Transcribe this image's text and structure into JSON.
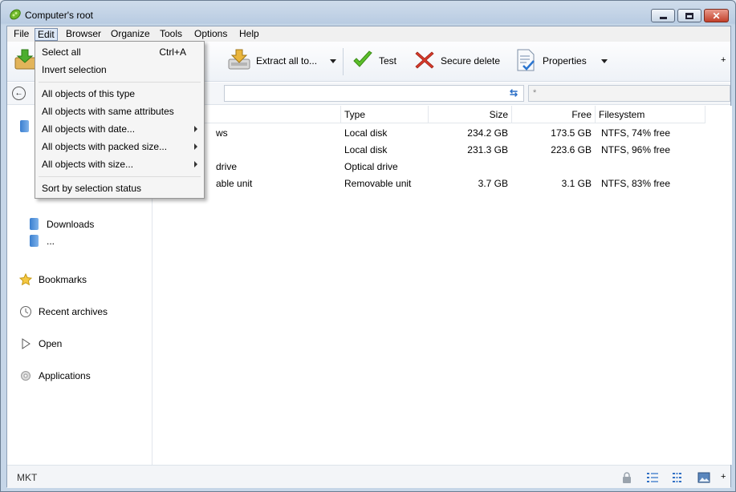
{
  "window": {
    "title": "Computer's root"
  },
  "menubar": {
    "items": [
      "File",
      "Edit",
      "Browser",
      "Organize",
      "Tools",
      "Options",
      "Help"
    ]
  },
  "toolbar": {
    "extract_all": "Extract all to...",
    "test": "Test",
    "secure_delete": "Secure delete",
    "properties": "Properties",
    "more": "+"
  },
  "address": {
    "filter_placeholder": "*"
  },
  "sidebar": {
    "folders": [
      "Downloads",
      "..."
    ],
    "bookmarks": "Bookmarks",
    "recent": "Recent archives",
    "open": "Open",
    "applications": "Applications"
  },
  "table": {
    "columns": [
      "Type",
      "Size",
      "Free",
      "Filesystem"
    ],
    "rows": [
      {
        "name": "ws",
        "type": "Local disk",
        "size": "234.2 GB",
        "free": "173.5 GB",
        "fs": "NTFS, 74% free"
      },
      {
        "name": "",
        "type": "Local disk",
        "size": "231.3 GB",
        "free": "223.6 GB",
        "fs": "NTFS, 96% free"
      },
      {
        "name": "drive",
        "type": "Optical drive",
        "size": "",
        "free": "",
        "fs": ""
      },
      {
        "name": "able unit",
        "type": "Removable unit",
        "size": "3.7 GB",
        "free": "3.1 GB",
        "fs": "NTFS, 83% free"
      }
    ]
  },
  "edit_menu": {
    "select_all": "Select all",
    "select_all_shortcut": "Ctrl+A",
    "invert": "Invert selection",
    "same_type": "All objects of this type",
    "same_attrs": "All objects with same attributes",
    "with_date": "All objects with date...",
    "packed_size": "All objects with packed size...",
    "with_size": "All objects with size...",
    "sort_status": "Sort by selection status"
  },
  "status": {
    "text": "MKT",
    "more": "+"
  }
}
